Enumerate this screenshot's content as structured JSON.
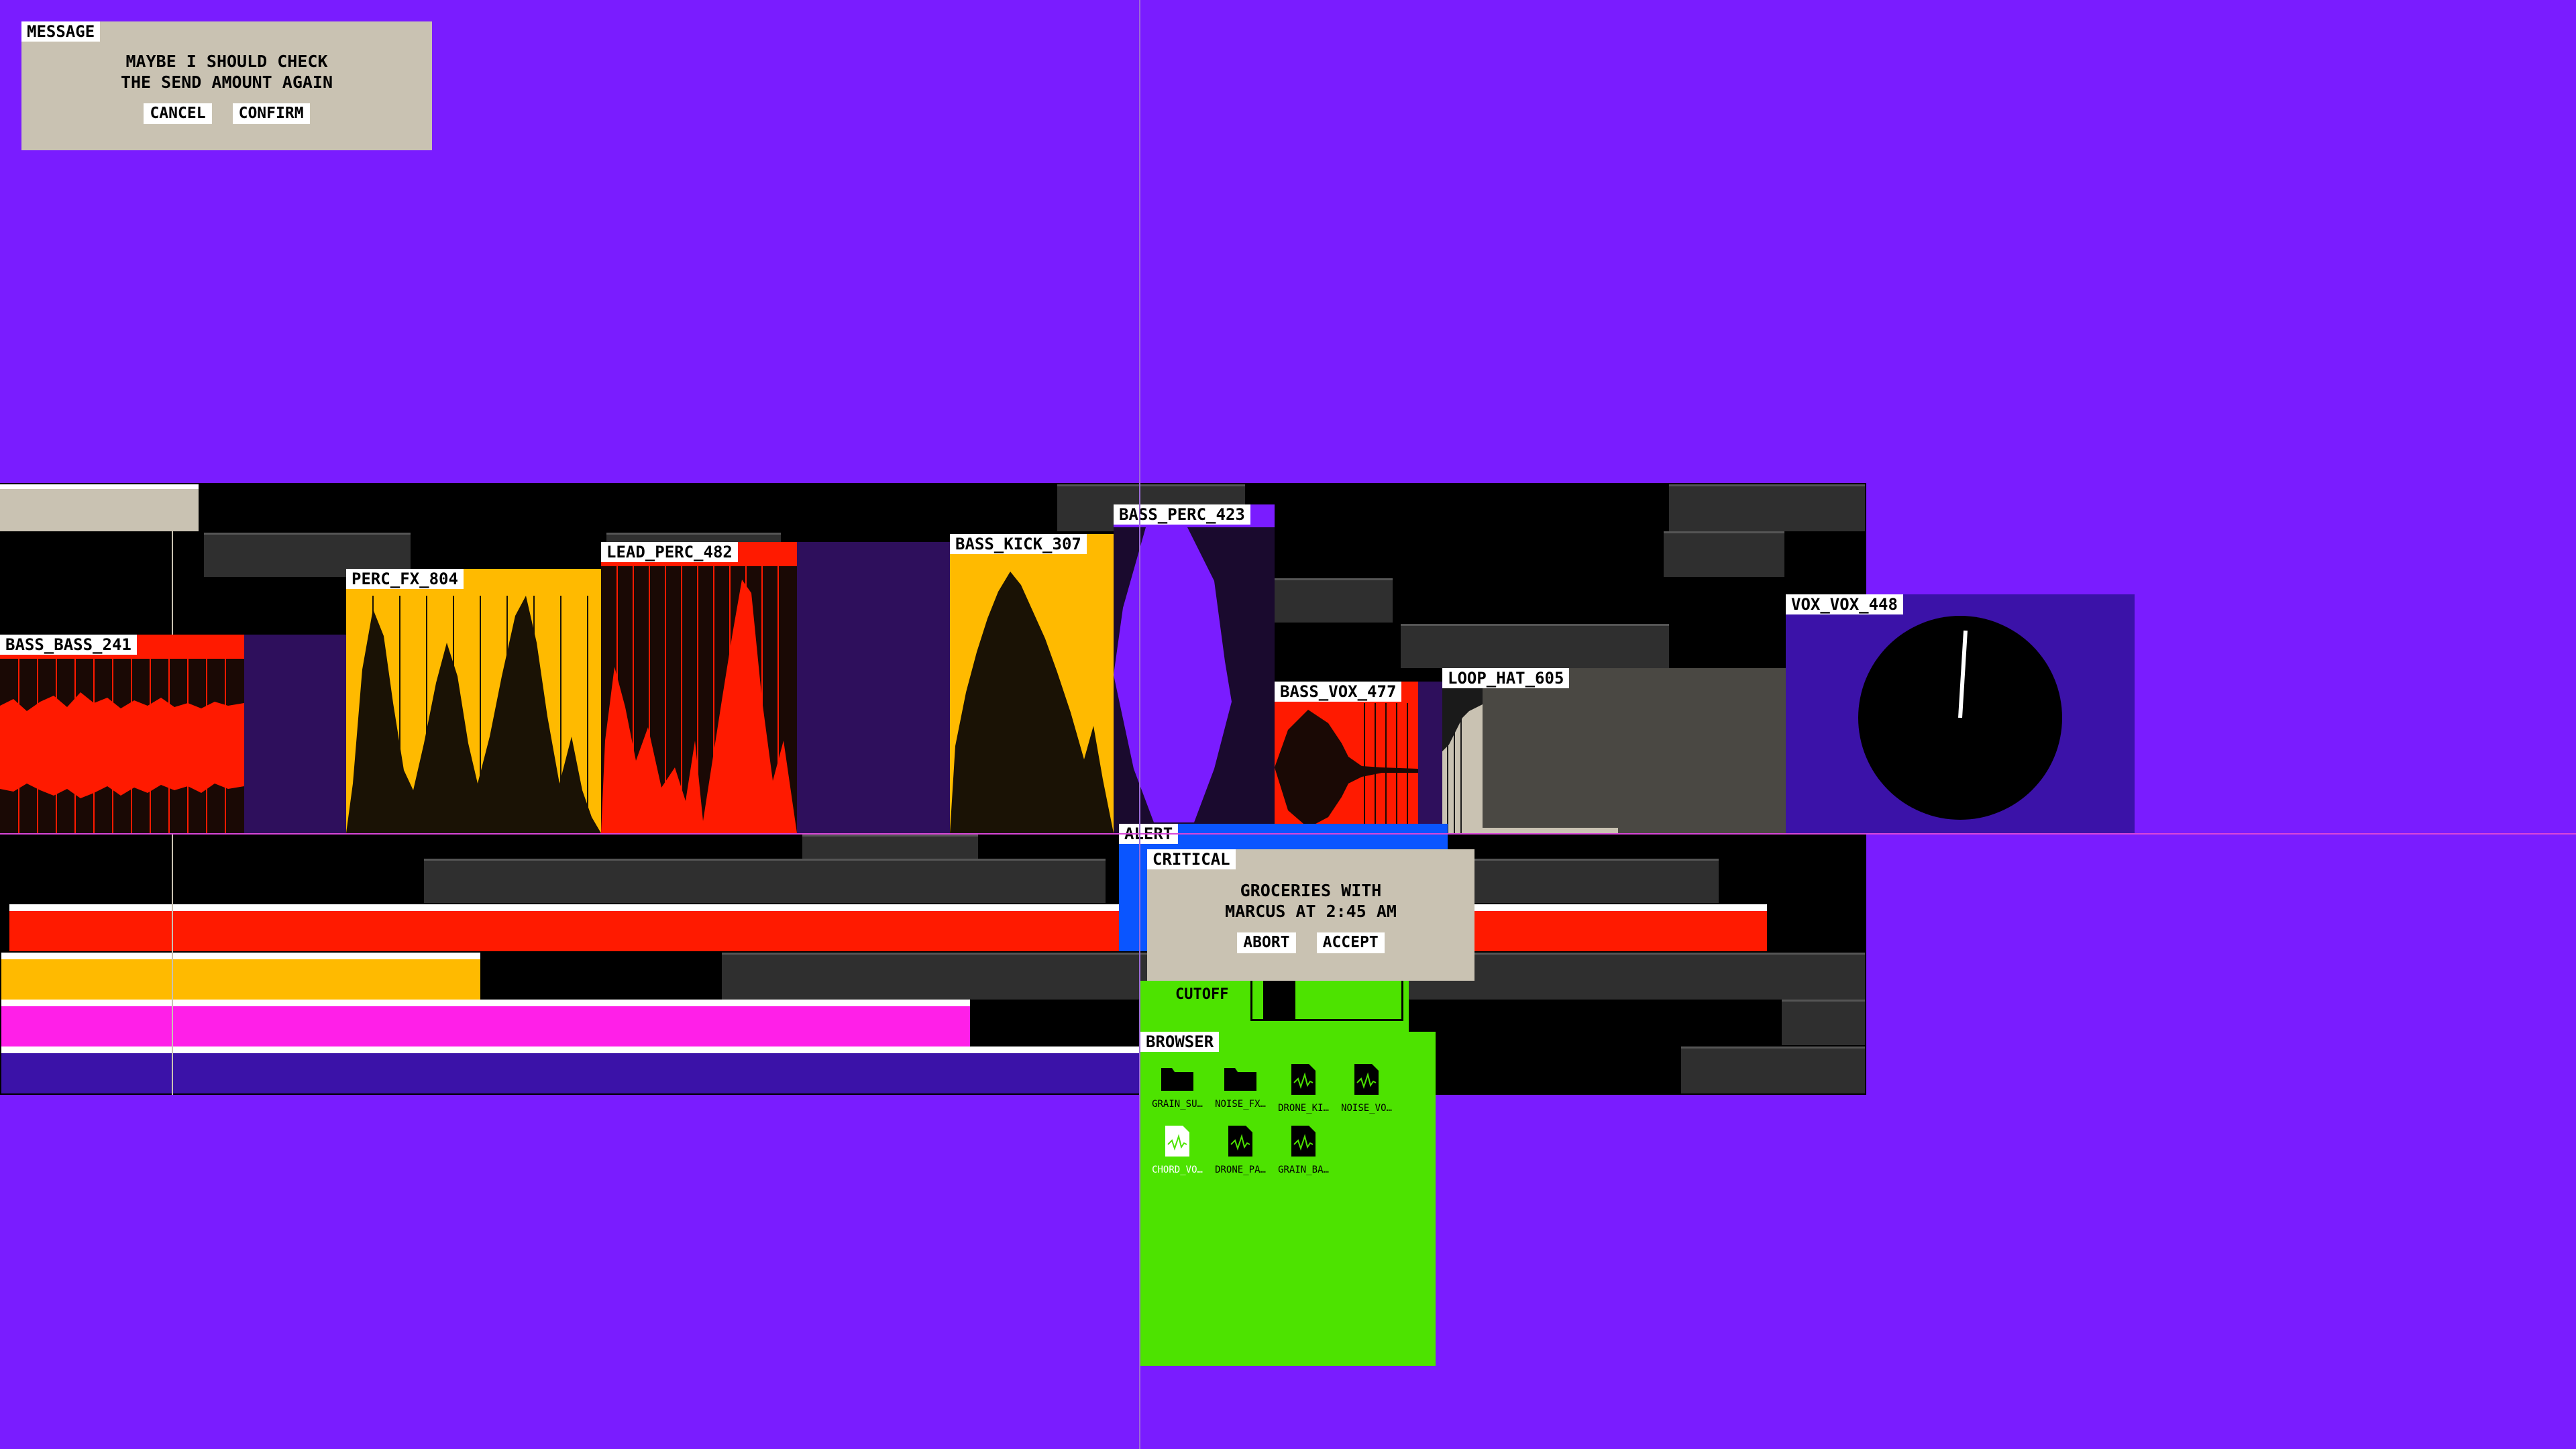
{
  "message_dialog": {
    "title": "MESSAGE",
    "line1": "MAYBE I SHOULD CHECK",
    "line2": "THE SEND AMOUNT AGAIN",
    "cancel": "CANCEL",
    "confirm": "CONFIRM"
  },
  "clips": [
    {
      "name": "BASS_BASS_241",
      "color": "#ff1a00"
    },
    {
      "name": "PERC_FX_804",
      "color": "#ffba00"
    },
    {
      "name": "LEAD_PERC_482",
      "color": "#ff1a00"
    },
    {
      "name": "BASS_KICK_307",
      "color": "#ffba00"
    },
    {
      "name": "BASS_PERC_423",
      "color": "#7a1cff"
    },
    {
      "name": "BASS_VOX_477",
      "color": "#ff1a00"
    },
    {
      "name": "LOOP_HAT_605",
      "color": "#c9c2b2"
    },
    {
      "name": "VOX_VOX_448",
      "color": "#3b12a8"
    }
  ],
  "alert_dialog": {
    "title": "ALERT",
    "subtitle": "CRITICAL",
    "line1": "GROCERIES WITH",
    "line2": "MARCUS AT 2:45 AM",
    "abort": "ABORT",
    "accept": "ACCEPT"
  },
  "filter": {
    "label": "CUTOFF"
  },
  "browser": {
    "title": "BROWSER",
    "items": [
      {
        "name": "GRAIN_SU…",
        "type": "folder-icon"
      },
      {
        "name": "NOISE_FX…",
        "type": "folder-icon"
      },
      {
        "name": "DRONE_KI…",
        "type": "audio-file-icon"
      },
      {
        "name": "NOISE_VO…",
        "type": "audio-file-icon"
      },
      {
        "name": "CHORD_VO…",
        "type": "audio-file-icon",
        "selected": true
      },
      {
        "name": "DRONE_PA…",
        "type": "audio-file-icon"
      },
      {
        "name": "GRAIN_BA…",
        "type": "audio-file-icon"
      }
    ]
  },
  "colors": {
    "background": "#7a1cff",
    "red": "#ff1a00",
    "amber": "#ffba00",
    "magenta": "#ff1fe8",
    "green": "#4de300",
    "blue": "#0a55ff",
    "beige": "#c9c2b2"
  }
}
